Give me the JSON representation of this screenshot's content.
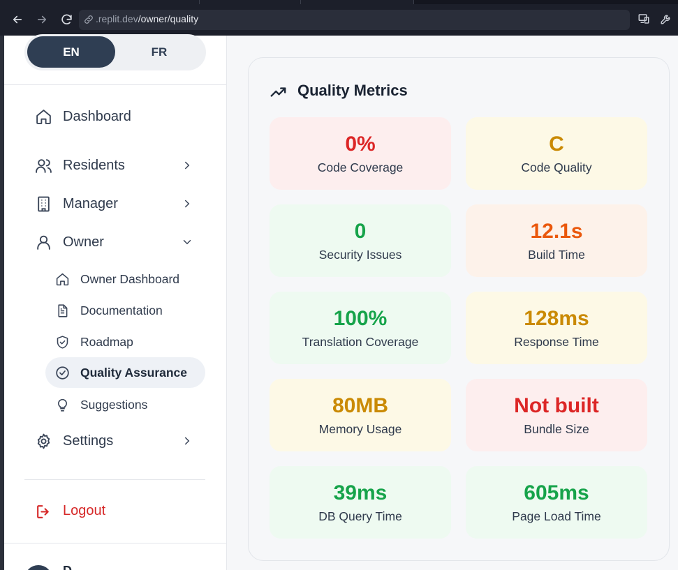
{
  "browser": {
    "url_domain": ".replit.dev",
    "url_path": "/owner/quality"
  },
  "sidebar": {
    "language": {
      "options": [
        "EN",
        "FR"
      ],
      "selected": "EN"
    },
    "items": [
      {
        "label": "Dashboard",
        "icon": "home-icon"
      },
      {
        "label": "Residents",
        "icon": "users-icon",
        "expandable": true
      },
      {
        "label": "Manager",
        "icon": "building-icon",
        "expandable": true
      },
      {
        "label": "Owner",
        "icon": "user-icon",
        "expanded": true
      },
      {
        "label": "Settings",
        "icon": "gear-icon",
        "expandable": true
      }
    ],
    "owner_subitems": [
      {
        "label": "Owner Dashboard",
        "icon": "home-icon"
      },
      {
        "label": "Documentation",
        "icon": "document-icon"
      },
      {
        "label": "Roadmap",
        "icon": "shield-icon"
      },
      {
        "label": "Quality Assurance",
        "icon": "check-circle-icon",
        "active": true
      },
      {
        "label": "Suggestions",
        "icon": "lightbulb-icon"
      }
    ],
    "logout": "Logout",
    "profile_name": "D"
  },
  "main": {
    "title": "Quality Metrics",
    "metrics": [
      {
        "value": "0%",
        "label": "Code Coverage",
        "status": "red"
      },
      {
        "value": "C",
        "label": "Code Quality",
        "status": "yellow"
      },
      {
        "value": "0",
        "label": "Security Issues",
        "status": "green"
      },
      {
        "value": "12.1s",
        "label": "Build Time",
        "status": "orange"
      },
      {
        "value": "100%",
        "label": "Translation Coverage",
        "status": "green"
      },
      {
        "value": "128ms",
        "label": "Response Time",
        "status": "yellow"
      },
      {
        "value": "80MB",
        "label": "Memory Usage",
        "status": "yellow"
      },
      {
        "value": "Not built",
        "label": "Bundle Size",
        "status": "red"
      },
      {
        "value": "39ms",
        "label": "DB Query Time",
        "status": "green"
      },
      {
        "value": "605ms",
        "label": "Page Load Time",
        "status": "green"
      }
    ]
  },
  "colors": {
    "red": "#dc2626",
    "yellow": "#ca8a04",
    "green": "#16a34a",
    "orange": "#ea580c",
    "accent": "#2f3e53"
  }
}
